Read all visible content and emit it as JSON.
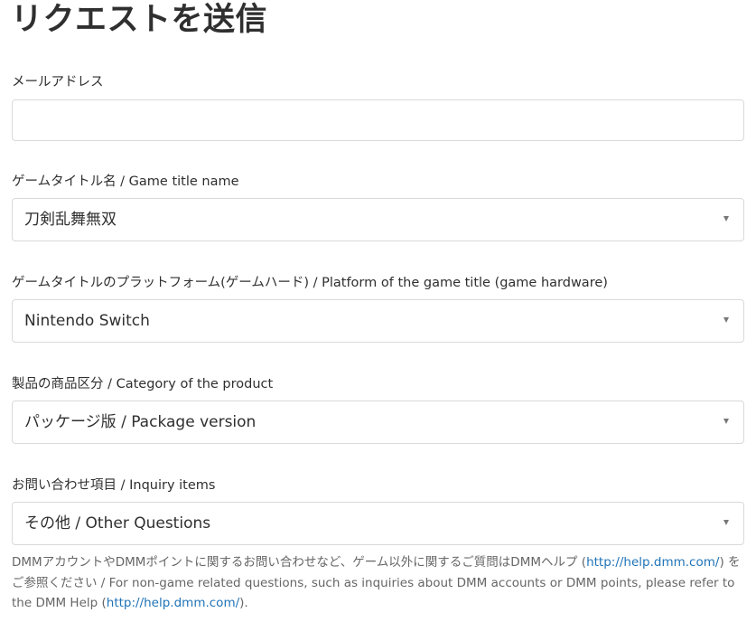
{
  "page": {
    "title": "リクエストを送信"
  },
  "form": {
    "email": {
      "label": "メールアドレス",
      "value": ""
    },
    "game_title": {
      "label": "ゲームタイトル名 / Game title name",
      "value": "刀剣乱舞無双"
    },
    "platform": {
      "label": "ゲームタイトルのプラットフォーム(ゲームハード) / Platform of the game title (game hardware)",
      "value": "Nintendo Switch"
    },
    "product_category": {
      "label": "製品の商品区分 / Category of the product",
      "value": "パッケージ版 / Package version"
    },
    "inquiry_item": {
      "label": "お問い合わせ項目 / Inquiry items",
      "value": "その他 / Other Questions"
    },
    "help": {
      "text_1": "DMMアカウントやDMMポイントに関するお問い合わせなど、ゲーム以外に関するご質問はDMMヘルプ (",
      "link_1": "http://help.dmm.com/",
      "text_2": ") をご参照ください / For non-game related questions, such as inquiries about DMM accounts or DMM points, please refer to the DMM Help (",
      "link_2": "http://help.dmm.com/",
      "text_3": ")."
    }
  },
  "colors": {
    "link": "#1f73b7",
    "border": "#d9d9d9",
    "text": "#2f2f2f"
  },
  "icons": {
    "select_arrow": "chevron-down-icon"
  }
}
